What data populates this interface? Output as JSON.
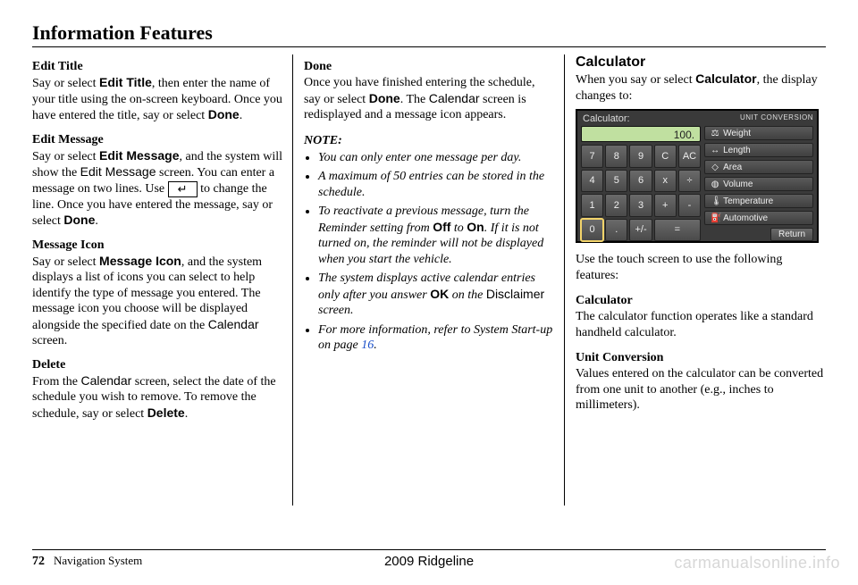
{
  "page_title": "Information Features",
  "footer": {
    "page_number": "72",
    "section": "Navigation System",
    "model": "2009  Ridgeline"
  },
  "watermark": "carmanualsonline.info",
  "col1": {
    "edit_title_h": "Edit Title",
    "edit_title_p1a": "Say or select ",
    "edit_title_p1b": "Edit Title",
    "edit_title_p1c": ", then enter the name of your title using the on-screen keyboard. Once you have entered the title, say or select ",
    "edit_title_p1d": "Done",
    "edit_title_p1e": ".",
    "edit_msg_h": "Edit Message",
    "edit_msg_a": "Say or select ",
    "edit_msg_b": "Edit Message",
    "edit_msg_c": ", and the system will show the ",
    "edit_msg_d": "Edit Message",
    "edit_msg_e": " screen. You can enter a message on two lines. Use ",
    "edit_msg_f": " to change the line. Once you have entered the message, say or select ",
    "edit_msg_g": "Done",
    "edit_msg_h2": ".",
    "msg_icon_h": "Message Icon",
    "msg_icon_a": "Say or select ",
    "msg_icon_b": "Message Icon",
    "msg_icon_c": ", and the system displays a list of icons you can select to help identify the type of message you entered. The message icon you choose will be displayed alongside the specified date on the ",
    "msg_icon_d": "Calendar",
    "msg_icon_e": " screen.",
    "delete_h": "Delete",
    "delete_a": "From the ",
    "delete_b": "Calendar",
    "delete_c": " screen, select the date of the schedule you wish to remove. To remove the schedule, say or select ",
    "delete_d": "Delete",
    "delete_e": "."
  },
  "col2": {
    "done_h": "Done",
    "done_a": "Once you have finished entering the schedule, say or select ",
    "done_b": "Done",
    "done_c": ". The ",
    "done_d": "Calendar",
    "done_e": " screen is redisplayed and a message icon appears.",
    "note_h": "NOTE:",
    "note1": "You can only enter one message per day.",
    "note2": "A maximum of 50 entries can be stored in the schedule.",
    "note3a": "To reactivate a previous message, turn the Reminder setting from ",
    "note3b": "Off",
    "note3c": " to ",
    "note3d": "On",
    "note3e": ". If it is not turned on, the reminder will not be displayed when you start the vehicle.",
    "note4a": "The system displays active calendar entries only after you answer ",
    "note4b": "OK",
    "note4c": " on the ",
    "note4d": "Disclaimer",
    "note4e": " screen.",
    "note5a": "For more information, refer to System Start-up on page ",
    "note5b": "16",
    "note5c": "."
  },
  "col3": {
    "calc_h": "Calculator",
    "calc_intro_a": "When you say or select ",
    "calc_intro_b": "Calculator",
    "calc_intro_c": ", the display changes to:",
    "use_touch": "Use the touch screen to use the following features:",
    "calc_sub_h": "Calculator",
    "calc_sub_p": "The calculator function operates like a standard handheld calculator.",
    "uc_h": "Unit Conversion",
    "uc_p": "Values entered on the calculator can be converted from one unit to another (e.g., inches to millimeters).",
    "screen": {
      "title": "Calculator:",
      "uc_title": "UNIT CONVERSION",
      "display": "100.",
      "keys": [
        "7",
        "8",
        "9",
        "C",
        "AC",
        "4",
        "5",
        "6",
        "x",
        "÷",
        "1",
        "2",
        "3",
        "+",
        "-",
        "0",
        ".",
        "+/-",
        "=",
        ""
      ],
      "units": [
        {
          "icon": "⚖",
          "label": "Weight"
        },
        {
          "icon": "↔",
          "label": "Length"
        },
        {
          "icon": "◇",
          "label": "Area"
        },
        {
          "icon": "◍",
          "label": "Volume"
        },
        {
          "icon": "🌡",
          "label": "Temperature"
        },
        {
          "icon": "⛽",
          "label": "Automotive"
        }
      ],
      "return": "Return"
    }
  }
}
